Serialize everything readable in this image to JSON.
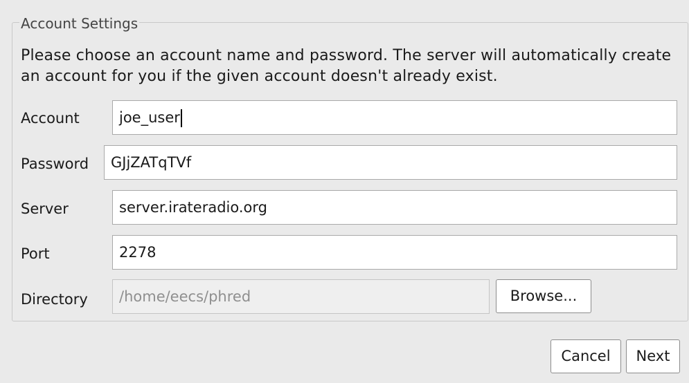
{
  "group": {
    "title": "Account Settings",
    "description": "Please choose an account name and password. The server will automatically create an account for you if the given account doesn't already exist."
  },
  "fields": {
    "account": {
      "label": "Account",
      "value": "joe_user"
    },
    "password": {
      "label": "Password",
      "value": "GJjZATqTVf"
    },
    "server": {
      "label": "Server",
      "value": "server.irateradio.org"
    },
    "port": {
      "label": "Port",
      "value": "2278"
    },
    "directory": {
      "label": "Directory",
      "value": "/home/eecs/phred",
      "enabled": false
    }
  },
  "buttons": {
    "browse": "Browse...",
    "cancel": "Cancel",
    "next": "Next"
  }
}
